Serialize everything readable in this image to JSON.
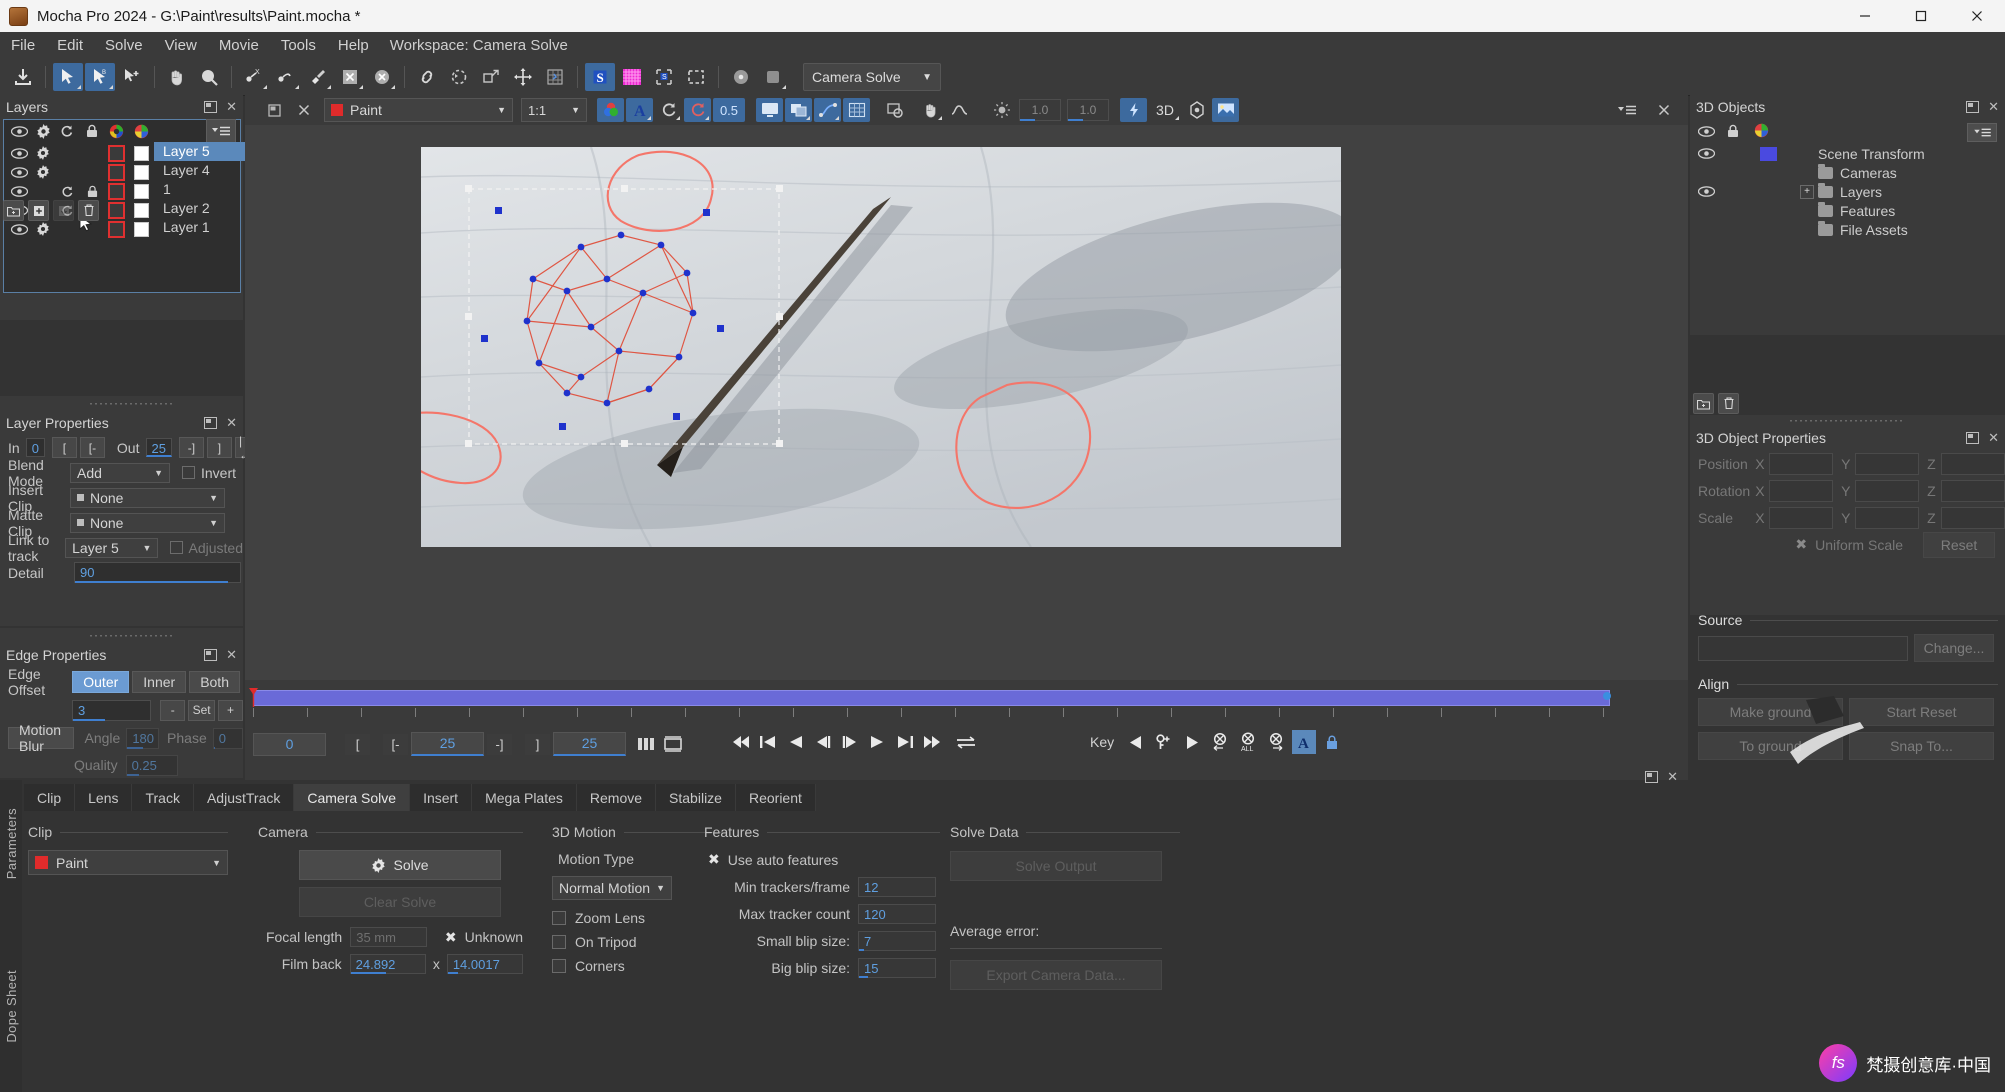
{
  "window": {
    "title": "Mocha Pro 2024 - G:\\Paint\\results\\Paint.mocha *",
    "minimize": "—",
    "maximize": "☐",
    "close": "✕"
  },
  "menu": {
    "items": [
      "File",
      "Edit",
      "Solve",
      "View",
      "Movie",
      "Tools",
      "Help"
    ],
    "workspace_label": "Workspace: Camera Solve"
  },
  "toolbar": {
    "workspace_value": "Camera Solve",
    "icons": [
      "import-icon",
      "select-tool-icon",
      "select-b-tool-icon",
      "add-point-tool-icon",
      "pan-tool-icon",
      "zoom-tool-icon",
      "pen-x-tool-icon",
      "pen-spline-tool-icon",
      "brush-tool-icon",
      "x-mask-icon",
      "x-circle-icon",
      "link-icon",
      "roto-icon",
      "transform-icon",
      "move-icon",
      "grid-warp-icon",
      "surface-icon",
      "grid-icon",
      "align-surface-icon",
      "planar-region-icon",
      "lens-icon",
      "stabilize-icon"
    ]
  },
  "viewer_toolbar": {
    "clip_name": "Paint",
    "clip_color": "#e02b2b",
    "zoom_value": "1:1",
    "opacity_value": "0.5",
    "gamma_value": "1.0",
    "exposure_value": "1.0",
    "mode_3d": "3D",
    "icons": [
      "pin-icon",
      "close-icon",
      "channels-icon",
      "alpha-icon",
      "matte-icon",
      "overlay-icon",
      "opacity-icon",
      "monitor-icon",
      "layers-view-icon",
      "spline-view-icon",
      "grid-view-icon",
      "zoom-region-icon",
      "hand-icon",
      "curve-icon",
      "brightness-icon",
      "lightning-icon",
      "3d-view-icon",
      "gizmo-icon",
      "image-view-icon"
    ]
  },
  "layers_panel": {
    "title": "Layers",
    "column_icons": [
      "eye-icon",
      "gear-icon",
      "refresh-icon",
      "lock-icon",
      "color-wheel-icon",
      "color-swatch-icon"
    ],
    "menu_icon": "panel-menu-icon",
    "rows": [
      {
        "name": "Layer 5",
        "selected": true,
        "eye": true,
        "gear": true,
        "refresh": false,
        "lock": false
      },
      {
        "name": "Layer 4",
        "selected": false,
        "eye": true,
        "gear": true,
        "refresh": false,
        "lock": false
      },
      {
        "name": "1",
        "selected": false,
        "eye": true,
        "gear": false,
        "refresh": true,
        "lock": true
      },
      {
        "name": "Layer 2",
        "selected": false,
        "eye": true,
        "gear": false,
        "refresh": true,
        "lock": false
      },
      {
        "name": "Layer 1",
        "selected": false,
        "eye": true,
        "gear": true,
        "refresh": false,
        "lock": false
      }
    ],
    "tool_icons": [
      "new-folder-icon",
      "add-layer-icon",
      "duplicate-layer-icon",
      "delete-layer-icon"
    ]
  },
  "layer_properties": {
    "title": "Layer Properties",
    "in_label": "In",
    "in_value": "0",
    "out_label": "Out",
    "out_value": "25",
    "in_btn1": "[",
    "in_btn2": "[-",
    "out_btn1": "-]",
    "out_btn2": "]",
    "out_btn3": "|←|",
    "blend_mode_label": "Blend Mode",
    "blend_mode_value": "Add",
    "invert_label": "Invert",
    "insert_clip_label": "Insert Clip",
    "insert_clip_value": "None",
    "matte_clip_label": "Matte Clip",
    "matte_clip_value": "None",
    "link_label": "Link to track",
    "link_value": "Layer 5",
    "adjusted_label": "Adjusted",
    "detail_label": "Detail",
    "detail_value": "90"
  },
  "edge_properties": {
    "title": "Edge Properties",
    "edge_offset_label": "Edge Offset",
    "segments": [
      "Outer",
      "Inner",
      "Both"
    ],
    "selected_segment": "Outer",
    "offset_value": "3",
    "minus_label": "-",
    "set_label": "Set",
    "plus_label": "+",
    "motion_blur_label": "Motion Blur",
    "angle_label": "Angle",
    "angle_value": "180",
    "phase_label": "Phase",
    "phase_value": "0",
    "quality_label": "Quality",
    "quality_value": "0.25"
  },
  "timeline": {
    "current_frame": "0",
    "in_point": "25",
    "out_point": "25",
    "mark_in_btn": "[",
    "mark_in2_btn": "[-",
    "mark_out_btn": "-]",
    "mark_out2_btn": "]",
    "transport_icons": [
      "first-frame-icon",
      "prev-keyframe-icon",
      "play-backward-icon",
      "step-backward-icon",
      "step-forward-icon",
      "play-forward-icon",
      "next-keyframe-icon",
      "last-frame-icon",
      "loop-icon"
    ],
    "key_label": "Key",
    "key_icons": [
      "prev-key-icon",
      "add-key-icon",
      "next-key-icon",
      "delete-key-left-icon",
      "delete-key-all-icon",
      "delete-key-right-icon",
      "auto-key-icon",
      "key-lock-icon"
    ],
    "key_all_label": "ALL",
    "autokey_label": "A"
  },
  "objects_panel": {
    "title": "3D Objects",
    "column_icons": [
      "eye-icon",
      "lock-icon",
      "color-wheel-icon"
    ],
    "menu_icon": "panel-menu-icon",
    "rows": [
      {
        "name": "Scene Transform",
        "eye": true,
        "swatch": "#4a4ae0",
        "indent": 0,
        "folder": false,
        "expand": false
      },
      {
        "name": "Cameras",
        "eye": false,
        "swatch": null,
        "indent": 1,
        "folder": true,
        "expand": false
      },
      {
        "name": "Layers",
        "eye": true,
        "swatch": null,
        "indent": 1,
        "folder": true,
        "expand": true
      },
      {
        "name": "Features",
        "eye": false,
        "swatch": null,
        "indent": 1,
        "folder": true,
        "expand": false
      },
      {
        "name": "File Assets",
        "eye": false,
        "swatch": null,
        "indent": 1,
        "folder": true,
        "expand": false
      }
    ],
    "tool_icons": [
      "new-folder-icon",
      "delete-object-icon"
    ]
  },
  "object_properties": {
    "title": "3D Object Properties",
    "position_label": "Position",
    "rotation_label": "Rotation",
    "scale_label": "Scale",
    "x_label": "X",
    "y_label": "Y",
    "z_label": "Z",
    "uniform_scale_label": "Uniform Scale",
    "reset_label": "Reset",
    "source_label": "Source",
    "source_value": "",
    "change_label": "Change...",
    "align_label": "Align",
    "make_ground_label": "Make ground",
    "start_reset_label": "Start  Reset",
    "to_ground_label": "To ground",
    "snap_to_label": "Snap To..."
  },
  "params": {
    "side_labels": [
      "Parameters",
      "Dope Sheet"
    ],
    "tabs": [
      "Clip",
      "Lens",
      "Track",
      "AdjustTrack",
      "Camera Solve",
      "Insert",
      "Mega Plates",
      "Remove",
      "Stabilize",
      "Reorient"
    ],
    "active_tab": "Camera Solve",
    "clip": {
      "group_label": "Clip",
      "value": "Paint",
      "color": "#e02b2b"
    },
    "camera": {
      "group_label": "Camera",
      "solve_label": "Solve",
      "clear_solve_label": "Clear Solve",
      "focal_length_label": "Focal length",
      "focal_length_placeholder": "35 mm",
      "unknown_label": "Unknown",
      "film_back_label": "Film back",
      "film_back_x": "24.892",
      "film_back_sep": "x",
      "film_back_y": "14.0017"
    },
    "motion_3d": {
      "group_label": "3D Motion",
      "motion_type_label": "Motion Type",
      "motion_type_value": "Normal Motion",
      "zoom_lens_label": "Zoom Lens",
      "on_tripod_label": "On Tripod",
      "corners_label": "Corners"
    },
    "features": {
      "group_label": "Features",
      "use_auto_label": "Use auto features",
      "min_trackers_label": "Min trackers/frame",
      "min_trackers_value": "12",
      "max_tracker_label": "Max tracker count",
      "max_tracker_value": "120",
      "small_blip_label": "Small blip size:",
      "small_blip_value": "7",
      "big_blip_label": "Big blip size:",
      "big_blip_value": "15"
    },
    "solve_data": {
      "group_label": "Solve Data",
      "solve_output_label": "Solve Output",
      "average_error_label": "Average error:",
      "export_label": "Export Camera Data..."
    }
  },
  "watermark": {
    "logo": "fs",
    "text": "梵摄创意库·中国"
  },
  "colors": {
    "accent": "#3f7fd0",
    "selection": "#5b89bb",
    "value_blue": "#5f9fe0",
    "clip_red": "#e02b2b",
    "spline_red": "#f4766a",
    "tracker_blue": "#2a3fd8"
  }
}
